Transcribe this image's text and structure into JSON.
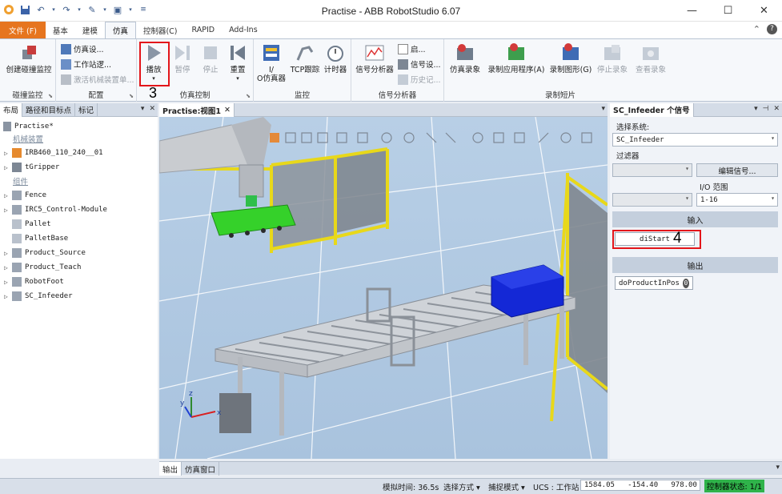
{
  "window": {
    "title": "Practise - ABB RobotStudio 6.07"
  },
  "tabs": {
    "file": "文件 (F)",
    "basic": "基本",
    "modeling": "建模",
    "simulation": "仿真",
    "controller": "控制器(C)",
    "rapid": "RAPID",
    "addins": "Add-Ins"
  },
  "ribbon": {
    "collision": {
      "create_label": "创建碰撞监控",
      "group_label": "碰撞监控"
    },
    "config": {
      "sim_setup": "仿真设...",
      "station_logic": "工作站逻...",
      "activate_mech": "激活机械装置单...",
      "group_label": "配置"
    },
    "control": {
      "play": "播放",
      "pause": "暂停",
      "stop": "停止",
      "reset": "重置",
      "group_label": "仿真控制"
    },
    "monitor": {
      "io_sim": "I/\nO仿真器",
      "tcp_trace": "TCP跟踪",
      "timer": "计时器",
      "group_label": "监控"
    },
    "signal": {
      "signal_analyzer": "信号分析器",
      "enable": "启...",
      "signal_setup": "信号设...",
      "history": "历史记...",
      "group_label": "信号分析器"
    },
    "record": {
      "sim_record": "仿真录象",
      "record_app": "录制应用程序(A)",
      "record_graphics": "录制图形(G)",
      "stop_record": "停止录象",
      "view_record": "查看录象",
      "group_label": "录制短片"
    }
  },
  "left_panel": {
    "tabs": [
      "布局",
      "路径和目标点",
      "标记"
    ],
    "station": "Practise*",
    "mech_header": "机械装置",
    "components_header": "组件",
    "mech_items": [
      "IRB460_110_240__01",
      "tGripper"
    ],
    "component_items": [
      "Fence",
      "IRC5_Control-Module",
      "Pallet",
      "PalletBase",
      "Product_Source",
      "Product_Teach",
      "RobotFoot",
      "SC_Infeeder"
    ]
  },
  "viewport": {
    "tab_label": "Practise:视图1"
  },
  "right_panel": {
    "title": "SC_Infeeder 个信号",
    "select_system_label": "选择系统:",
    "system_value": "SC_Infeeder",
    "filter_label": "过滤器",
    "edit_signal_button": "编辑信号...",
    "io_range_label": "I/O 范围",
    "io_range_value": "1-16",
    "input_header": "输入",
    "inputs": [
      "diStart"
    ],
    "output_header": "输出",
    "outputs": [
      {
        "name": "doProductInPos",
        "value": "0"
      }
    ]
  },
  "bottom_tabs": [
    "输出",
    "仿真窗口"
  ],
  "status": {
    "sim_time": "模拟时间: 36.5s",
    "select_mode": "选择方式",
    "snap_mode": "捕捉模式",
    "ucs": "UCS : 工作站",
    "coords": "1584.05   -154.40   978.00",
    "controller_status": "控制器状态:",
    "controller_count": "1/1"
  },
  "annotations": {
    "play_marker": "3",
    "signal_marker": "4"
  },
  "colors": {
    "file_tab": "#e6751f",
    "highlight": "#e3151a",
    "fence": "#e8d81a",
    "gripper": "#35d12a",
    "box": "#1428d6",
    "status_ok": "#2fb34a"
  }
}
